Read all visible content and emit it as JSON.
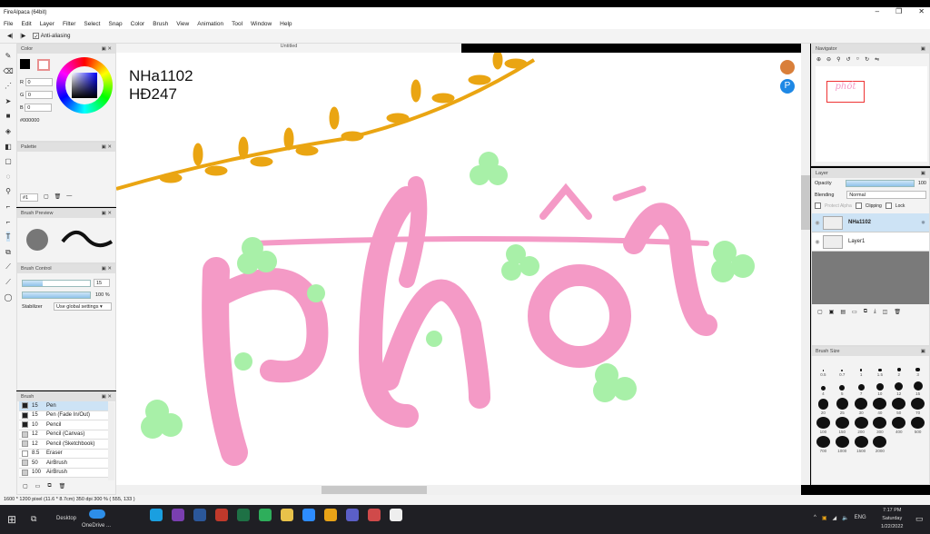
{
  "window": {
    "title": "FireAlpaca (64bit)",
    "doc_title": "Untitled"
  },
  "menu": [
    "File",
    "Edit",
    "Layer",
    "Filter",
    "Select",
    "Snap",
    "Color",
    "Brush",
    "View",
    "Animation",
    "Tool",
    "Window",
    "Help"
  ],
  "toolbar": {
    "antialias_label": "Anti-aliasing",
    "antialias_checked": true
  },
  "color_panel": {
    "title": "Color",
    "r": "0",
    "g": "0",
    "b": "0",
    "r_label": "R",
    "g_label": "G",
    "b_label": "B",
    "hex": "#000000",
    "primary": "#000000"
  },
  "palette_panel": {
    "title": "Palette",
    "selector": "#1"
  },
  "brush_preview": {
    "title": "Brush Preview"
  },
  "brush_control": {
    "title": "Brush Control",
    "size": "15",
    "opacity": "100 %",
    "opacity_value": 100,
    "stabilizer_label": "Stabilizer",
    "stabilizer_value": "Use global settings"
  },
  "brush_panel": {
    "title": "Brush",
    "items": [
      {
        "size": "15",
        "name": "Pen",
        "color": "#222",
        "selected": true
      },
      {
        "size": "15",
        "name": "Pen (Fade In/Out)",
        "color": "#222"
      },
      {
        "size": "10",
        "name": "Pencil",
        "color": "#222"
      },
      {
        "size": "12",
        "name": "Pencil (Canvas)",
        "color": "#ccc"
      },
      {
        "size": "12",
        "name": "Pencil (Sketchbook)",
        "color": "#ccc"
      },
      {
        "size": "8.5",
        "name": "Eraser",
        "color": "#fff"
      },
      {
        "size": "50",
        "name": "AirBrush",
        "color": "#ccc"
      },
      {
        "size": "100",
        "name": "AirBrush",
        "color": "#ccc"
      }
    ]
  },
  "canvas": {
    "text_line1": "NHa1102",
    "text_line2": "HĐ247",
    "lettering": "phốt",
    "pink": "#f49ac6",
    "green": "#a8f0a8",
    "vine": "#eaa512"
  },
  "navigator": {
    "title": "Navigator",
    "thumb_text": "phốt"
  },
  "layer_panel": {
    "title": "Layer",
    "opacity_label": "Opacity",
    "opacity": "100",
    "blending_label": "Blending",
    "blending": "Normal",
    "protect_alpha": "Protect Alpha",
    "clipping": "Clipping",
    "lock": "Lock",
    "layers": [
      {
        "name": "NHa1102",
        "selected": true
      },
      {
        "name": "Layer1",
        "selected": false
      }
    ]
  },
  "brush_size_panel": {
    "title": "Brush Size",
    "sizes": [
      "0.5",
      "0.7",
      "1",
      "1.5",
      "2",
      "3",
      "4",
      "5",
      "7",
      "10",
      "12",
      "15",
      "20",
      "25",
      "30",
      "40",
      "50",
      "70",
      "100",
      "150",
      "200",
      "300",
      "400",
      "500",
      "700",
      "1000",
      "1500",
      "2000"
    ]
  },
  "status": "1600 * 1200 pixel   (11.6 * 8.7cm)   350 dpi   300 %   ( 555, 133 )",
  "taskbar": {
    "desktop": "Desktop",
    "onedrive": "OneDrive ...",
    "time": "7:17 PM",
    "day": "Saturday",
    "date": "1/22/2022",
    "lang": "ENG",
    "apps": [
      {
        "name": "skype",
        "color": "#1a9fe0"
      },
      {
        "name": "app-purple",
        "color": "#7a3fb0"
      },
      {
        "name": "word",
        "color": "#2b579a"
      },
      {
        "name": "wifi-app",
        "color": "#c0392b"
      },
      {
        "name": "excel",
        "color": "#1e7145"
      },
      {
        "name": "app-green",
        "color": "#2eae5b"
      },
      {
        "name": "file-explorer",
        "color": "#e8c24a"
      },
      {
        "name": "zoom",
        "color": "#2d8cff"
      },
      {
        "name": "chrome",
        "color": "#e8a317"
      },
      {
        "name": "teams",
        "color": "#5b5fc7"
      },
      {
        "name": "chrome-profile",
        "color": "#d04a4a"
      },
      {
        "name": "firealpaca",
        "color": "#eee"
      }
    ]
  }
}
